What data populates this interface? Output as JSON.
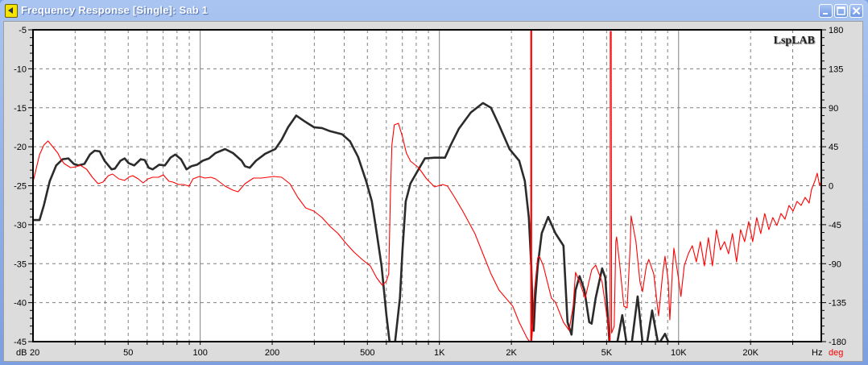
{
  "window": {
    "title": "Frequency Response [Single]: Sab 1",
    "buttons": [
      "minimize",
      "maximize",
      "close"
    ]
  },
  "colors": {
    "magnitude": "#2b2b2b",
    "phase": "#ff0000",
    "grid": "#808080"
  },
  "chart_data": {
    "type": "line",
    "logo": "LspLAB",
    "xscale": "log",
    "xlim": [
      20,
      39500
    ],
    "xlabel": "Hz",
    "x_ticks": [
      20,
      50,
      100,
      200,
      500,
      1000,
      2000,
      5000,
      10000,
      20000
    ],
    "x_tick_labels": [
      "20",
      "50",
      "100",
      "200",
      "500",
      "1K",
      "2K",
      "5K",
      "10K",
      "20K"
    ],
    "y_left": {
      "label": "dB",
      "lim": [
        -45,
        -5
      ],
      "ticks": [
        -5,
        -10,
        -15,
        -20,
        -25,
        -30,
        -35,
        -40,
        -45
      ],
      "tick_labels": [
        "-5",
        "-10",
        "-15",
        "-20",
        "-25",
        "-30",
        "-35",
        "-40",
        "-45"
      ]
    },
    "y_right": {
      "label": "deg",
      "lim": [
        -180,
        180
      ],
      "ticks": [
        180,
        135,
        90,
        45,
        0,
        -45,
        -90,
        -135,
        -180
      ],
      "tick_labels": [
        "180",
        "135",
        "90",
        "45",
        "0",
        "-45",
        "-90",
        "-135",
        "-180"
      ]
    },
    "grid": true,
    "series": [
      {
        "name": "magnitude",
        "axis": "left",
        "unit": "dB",
        "points": [
          [
            20,
            -29.4
          ],
          [
            21.3,
            -29.4
          ],
          [
            22.2,
            -27.5
          ],
          [
            23.5,
            -24.4
          ],
          [
            25.0,
            -22.4
          ],
          [
            26.6,
            -21.6
          ],
          [
            28.1,
            -21.5
          ],
          [
            29.6,
            -22.2
          ],
          [
            31.0,
            -22.4
          ],
          [
            32.8,
            -22.2
          ],
          [
            34.6,
            -21.0
          ],
          [
            36.2,
            -20.5
          ],
          [
            38.0,
            -20.6
          ],
          [
            39.8,
            -21.8
          ],
          [
            42.6,
            -22.9
          ],
          [
            44.0,
            -22.8
          ],
          [
            46.4,
            -21.8
          ],
          [
            48.3,
            -21.5
          ],
          [
            50.2,
            -22.1
          ],
          [
            53.0,
            -22.4
          ],
          [
            56.4,
            -21.6
          ],
          [
            58.6,
            -21.7
          ],
          [
            60.9,
            -22.7
          ],
          [
            63.3,
            -22.9
          ],
          [
            67.4,
            -22.3
          ],
          [
            71.2,
            -22.4
          ],
          [
            75.1,
            -21.4
          ],
          [
            78.7,
            -21.0
          ],
          [
            83.1,
            -21.6
          ],
          [
            87.7,
            -22.9
          ],
          [
            91.9,
            -22.5
          ],
          [
            97.0,
            -22.3
          ],
          [
            102.4,
            -21.8
          ],
          [
            108.9,
            -21.5
          ],
          [
            115.9,
            -20.8
          ],
          [
            127,
            -20.3
          ],
          [
            137,
            -20.8
          ],
          [
            149,
            -21.8
          ],
          [
            154,
            -22.5
          ],
          [
            161,
            -22.7
          ],
          [
            171,
            -21.8
          ],
          [
            187,
            -20.9
          ],
          [
            206,
            -20.3
          ],
          [
            219,
            -19.1
          ],
          [
            233,
            -17.5
          ],
          [
            252,
            -16.0
          ],
          [
            272,
            -16.7
          ],
          [
            299,
            -17.5
          ],
          [
            323,
            -17.6
          ],
          [
            349,
            -18.0
          ],
          [
            392,
            -18.4
          ],
          [
            423,
            -19.3
          ],
          [
            457,
            -21.3
          ],
          [
            494,
            -24.4
          ],
          [
            522,
            -27.0
          ],
          [
            547,
            -31.1
          ],
          [
            573,
            -35.3
          ],
          [
            600,
            -41.5
          ],
          [
            619,
            -45
          ],
          [
            631,
            -47
          ],
          [
            643,
            -47
          ],
          [
            653,
            -45
          ],
          [
            684,
            -39.4
          ],
          [
            701,
            -33.2
          ],
          [
            723,
            -27.0
          ],
          [
            757,
            -24.7
          ],
          [
            818,
            -22.9
          ],
          [
            870,
            -21.5
          ],
          [
            955,
            -21.4
          ],
          [
            1056,
            -21.4
          ],
          [
            1115,
            -19.8
          ],
          [
            1205,
            -17.7
          ],
          [
            1353,
            -15.6
          ],
          [
            1521,
            -14.4
          ],
          [
            1643,
            -15.0
          ],
          [
            1775,
            -17.2
          ],
          [
            1964,
            -20.3
          ],
          [
            2155,
            -21.8
          ],
          [
            2276,
            -24.4
          ],
          [
            2365,
            -29.1
          ],
          [
            2421,
            -35.3
          ],
          [
            2459,
            -42.5
          ],
          [
            2478,
            -43.6
          ],
          [
            2517,
            -39.4
          ],
          [
            2576,
            -35.3
          ],
          [
            2678,
            -31.1
          ],
          [
            2850,
            -29.0
          ],
          [
            3056,
            -31.1
          ],
          [
            3302,
            -32.7
          ],
          [
            3432,
            -42.5
          ],
          [
            3568,
            -44.1
          ],
          [
            3709,
            -38.4
          ],
          [
            3856,
            -36.6
          ],
          [
            4039,
            -38.4
          ],
          [
            4232,
            -42.5
          ],
          [
            4331,
            -42.7
          ],
          [
            4503,
            -39.4
          ],
          [
            4791,
            -35.6
          ],
          [
            4942,
            -36.8
          ],
          [
            5137,
            -45
          ],
          [
            5258,
            -47
          ],
          [
            5551,
            -45
          ],
          [
            5815,
            -41.6
          ],
          [
            6046,
            -45
          ],
          [
            6190,
            -47
          ],
          [
            6382,
            -45
          ],
          [
            6739,
            -39.2
          ],
          [
            7060,
            -45
          ],
          [
            7290,
            -47
          ],
          [
            7395,
            -45
          ],
          [
            7748,
            -41.0
          ],
          [
            8180,
            -45
          ],
          [
            8373,
            -45
          ],
          [
            8771,
            -44.0
          ],
          [
            9048,
            -45
          ],
          [
            9260,
            -47
          ]
        ]
      },
      {
        "name": "phase",
        "axis": "right",
        "unit": "deg",
        "points": [
          [
            20,
            4.2
          ],
          [
            20.6,
            19.1
          ],
          [
            21.3,
            35.8
          ],
          [
            22.2,
            47.0
          ],
          [
            23.1,
            51.6
          ],
          [
            24.0,
            46.1
          ],
          [
            25.4,
            37.7
          ],
          [
            26.2,
            30.2
          ],
          [
            27.0,
            25.6
          ],
          [
            28.7,
            20.9
          ],
          [
            30.3,
            21.9
          ],
          [
            31.5,
            23.7
          ],
          [
            33.5,
            19.1
          ],
          [
            35.4,
            9.8
          ],
          [
            37.4,
            2.3
          ],
          [
            39.2,
            4.2
          ],
          [
            41.3,
            11.6
          ],
          [
            43.0,
            13.5
          ],
          [
            45.7,
            7.9
          ],
          [
            48.3,
            6.1
          ],
          [
            50.2,
            9.8
          ],
          [
            52.2,
            11.6
          ],
          [
            55.1,
            7.9
          ],
          [
            57.7,
            3.3
          ],
          [
            60.5,
            7.9
          ],
          [
            63.3,
            9.8
          ],
          [
            66.9,
            9.8
          ],
          [
            70.1,
            12.6
          ],
          [
            74.0,
            5.1
          ],
          [
            76.9,
            4.2
          ],
          [
            81.2,
            1.4
          ],
          [
            85.0,
            1.4
          ],
          [
            89.8,
            -0.5
          ],
          [
            93.3,
            7.9
          ],
          [
            99.2,
            10.7
          ],
          [
            104.7,
            8.8
          ],
          [
            110.7,
            9.8
          ],
          [
            115.9,
            7.9
          ],
          [
            127,
            -0.5
          ],
          [
            137,
            -5.1
          ],
          [
            144,
            -7.0
          ],
          [
            154,
            2.3
          ],
          [
            167,
            8.8
          ],
          [
            180,
            8.8
          ],
          [
            203,
            10.7
          ],
          [
            219,
            9.8
          ],
          [
            237,
            2.3
          ],
          [
            256,
            -13.5
          ],
          [
            276,
            -25.6
          ],
          [
            299,
            -29.3
          ],
          [
            323,
            -36.7
          ],
          [
            349,
            -47.0
          ],
          [
            377,
            -55.3
          ],
          [
            407,
            -66.5
          ],
          [
            440,
            -76.7
          ],
          [
            475,
            -85.1
          ],
          [
            514,
            -92.5
          ],
          [
            547,
            -106.5
          ],
          [
            577,
            -114.9
          ],
          [
            600,
            -110.2
          ],
          [
            614,
            -101.8
          ],
          [
            624,
            -8.8
          ],
          [
            633,
            47.0
          ],
          [
            648,
            70.2
          ],
          [
            674,
            72.1
          ],
          [
            701,
            56.3
          ],
          [
            728,
            37.7
          ],
          [
            757,
            28.4
          ],
          [
            818,
            20.9
          ],
          [
            884,
            7.9
          ],
          [
            955,
            -1.4
          ],
          [
            1032,
            1.4
          ],
          [
            1081,
            -0.5
          ],
          [
            1159,
            -13.5
          ],
          [
            1252,
            -29.3
          ],
          [
            1407,
            -55.3
          ],
          [
            1521,
            -78.6
          ],
          [
            1643,
            -101.8
          ],
          [
            1775,
            -120.5
          ],
          [
            2026,
            -139.1
          ],
          [
            2155,
            -157.7
          ],
          [
            2329,
            -176.3
          ],
          [
            2384,
            -180
          ],
          [
            2410,
            -180
          ],
          [
            2410,
            180
          ],
          [
            2430,
            180
          ],
          [
            2430,
            -180
          ],
          [
            2460,
            -160
          ],
          [
            2497,
            -120.5
          ],
          [
            2576,
            -83.3
          ],
          [
            2616,
            -81.4
          ],
          [
            2720,
            -92.5
          ],
          [
            2939,
            -129.8
          ],
          [
            3056,
            -134.4
          ],
          [
            3302,
            -157.7
          ],
          [
            3486,
            -167.0
          ],
          [
            3624,
            -139.1
          ],
          [
            3709,
            -100.0
          ],
          [
            3856,
            -111.2
          ],
          [
            4070,
            -129.8
          ],
          [
            4331,
            -97.2
          ],
          [
            4503,
            -91.6
          ],
          [
            4791,
            -111.2
          ],
          [
            5058,
            -157.7
          ],
          [
            5137,
            -180
          ],
          [
            5170,
            -180
          ],
          [
            5180,
            178
          ],
          [
            5230,
            178
          ],
          [
            5250,
            -170
          ],
          [
            5381,
            -162.3
          ],
          [
            5465,
            -64.6
          ],
          [
            5508,
            -59.1
          ],
          [
            5682,
            -92.5
          ],
          [
            5906,
            -139.1
          ],
          [
            6093,
            -140.9
          ],
          [
            6286,
            -64.6
          ],
          [
            6333,
            -34.9
          ],
          [
            6635,
            -64.6
          ],
          [
            6897,
            -111.2
          ],
          [
            7060,
            -122.3
          ],
          [
            7338,
            -92.5
          ],
          [
            7511,
            -85.1
          ],
          [
            7869,
            -101.8
          ],
          [
            8245,
            -150.2
          ],
          [
            8578,
            -101.8
          ],
          [
            8771,
            -81.4
          ],
          [
            9048,
            -110.2
          ],
          [
            9190,
            -154.9
          ],
          [
            9406,
            -101.8
          ],
          [
            9553,
            -72.1
          ],
          [
            9923,
            -101.8
          ],
          [
            10230,
            -127.9
          ],
          [
            10560,
            -92.5
          ],
          [
            10980,
            -78.6
          ],
          [
            11410,
            -69.3
          ],
          [
            11860,
            -87.9
          ],
          [
            12330,
            -64.6
          ],
          [
            12820,
            -92.5
          ],
          [
            13320,
            -60.0
          ],
          [
            13850,
            -92.5
          ],
          [
            14400,
            -50.7
          ],
          [
            14970,
            -74.0
          ],
          [
            15560,
            -64.6
          ],
          [
            16170,
            -78.6
          ],
          [
            16800,
            -55.3
          ],
          [
            17480,
            -87.9
          ],
          [
            18170,
            -50.7
          ],
          [
            18890,
            -64.6
          ],
          [
            19640,
            -41.4
          ],
          [
            20410,
            -64.6
          ],
          [
            21220,
            -36.7
          ],
          [
            22060,
            -55.3
          ],
          [
            22930,
            -32.1
          ],
          [
            23840,
            -50.7
          ],
          [
            24780,
            -36.7
          ],
          [
            25760,
            -46.0
          ],
          [
            26780,
            -32.1
          ],
          [
            27840,
            -38.6
          ],
          [
            28940,
            -22.8
          ],
          [
            30090,
            -29.3
          ],
          [
            31280,
            -18.1
          ],
          [
            32510,
            -22.8
          ],
          [
            33800,
            -13.5
          ],
          [
            35130,
            -20.0
          ],
          [
            35960,
            -4.2
          ],
          [
            37090,
            5.1
          ],
          [
            37970,
            14.4
          ],
          [
            38860,
            0.5
          ],
          [
            39470,
            5.1
          ]
        ]
      }
    ]
  }
}
